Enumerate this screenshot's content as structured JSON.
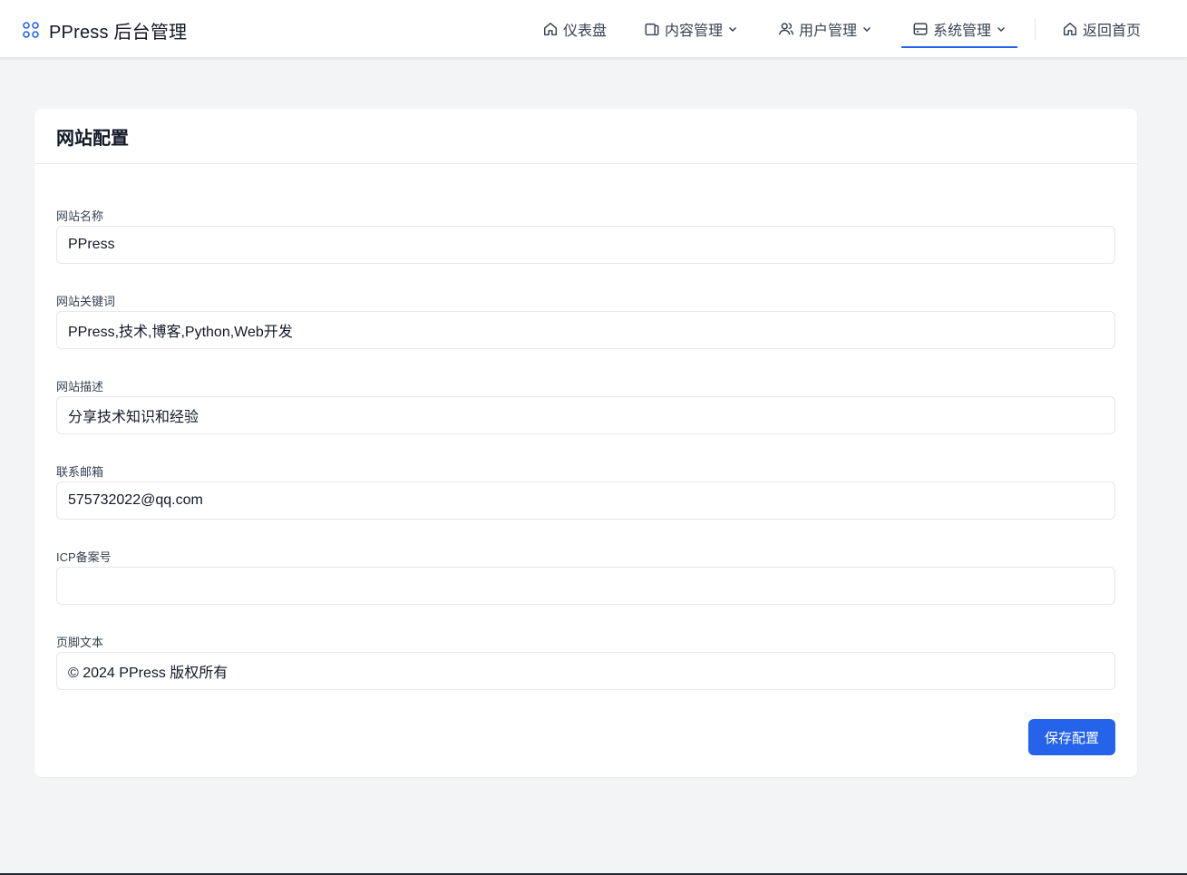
{
  "app": {
    "title": "PPress 后台管理",
    "brand_icon": "grid-icon"
  },
  "nav": {
    "items": [
      {
        "label": "仪表盘",
        "icon": "home-icon",
        "dropdown": false,
        "active": false
      },
      {
        "label": "内容管理",
        "icon": "document-icon",
        "dropdown": true,
        "active": false
      },
      {
        "label": "用户管理",
        "icon": "users-icon",
        "dropdown": true,
        "active": false
      },
      {
        "label": "系统管理",
        "icon": "server-icon",
        "dropdown": true,
        "active": true
      }
    ],
    "home_link": {
      "label": "返回首页",
      "icon": "home-icon"
    }
  },
  "settings": {
    "title": "网站配置",
    "fields": [
      {
        "label": "网站名称",
        "value": "PPress"
      },
      {
        "label": "网站关键词",
        "value": "PPress,技术,博客,Python,Web开发"
      },
      {
        "label": "网站描述",
        "value": "分享技术知识和经验"
      },
      {
        "label": "联系邮箱",
        "value": "575732022@qq.com"
      },
      {
        "label": "ICP备案号",
        "value": ""
      },
      {
        "label": "页脚文本",
        "value": "© 2024 PPress 版权所有"
      }
    ],
    "save_label": "保存配置"
  },
  "colors": {
    "accent": "#2563eb",
    "page_background": "#f3f4f6",
    "card_background": "#ffffff",
    "border": "#e5e7eb"
  }
}
